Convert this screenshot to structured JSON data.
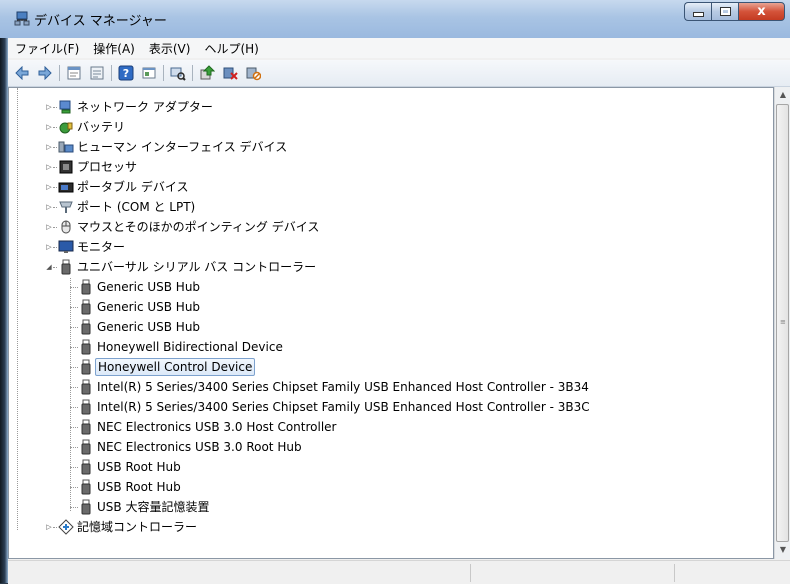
{
  "window": {
    "title": "デバイス マネージャー"
  },
  "caption_buttons": {
    "close_glyph": "x"
  },
  "menu": [
    {
      "label": "ファイル(F)"
    },
    {
      "label": "操作(A)"
    },
    {
      "label": "表示(V)"
    },
    {
      "label": "ヘルプ(H)"
    }
  ],
  "toolbar": [
    {
      "name": "back-icon"
    },
    {
      "name": "forward-icon"
    },
    {
      "name": "properties-icon"
    },
    {
      "name": "show-hide-icon"
    },
    {
      "name": "help-icon"
    },
    {
      "name": "console-icon"
    },
    {
      "name": "scan-hardware-icon"
    },
    {
      "name": "update-driver-icon"
    },
    {
      "name": "uninstall-icon"
    },
    {
      "name": "disable-icon"
    }
  ],
  "tree": {
    "categories_top": [
      {
        "label": "ネットワーク アダプター",
        "icon": "network-adapter-icon"
      },
      {
        "label": "バッテリ",
        "icon": "battery-icon"
      },
      {
        "label": "ヒューマン インターフェイス デバイス",
        "icon": "hid-icon"
      },
      {
        "label": "プロセッサ",
        "icon": "processor-icon"
      },
      {
        "label": "ポータブル デバイス",
        "icon": "portable-device-icon"
      },
      {
        "label": "ポート (COM と LPT)",
        "icon": "port-icon"
      },
      {
        "label": "マウスとそのほかのポインティング デバイス",
        "icon": "mouse-icon"
      },
      {
        "label": "モニター",
        "icon": "monitor-icon"
      }
    ],
    "expanded": {
      "label": "ユニバーサル シリアル バス コントローラー",
      "icon": "usb-icon",
      "children": [
        {
          "label": "Generic USB Hub"
        },
        {
          "label": "Generic USB Hub"
        },
        {
          "label": "Generic USB Hub"
        },
        {
          "label": "Honeywell Bidirectional Device"
        },
        {
          "label": "Honeywell Control Device",
          "selected": true
        },
        {
          "label": "Intel(R) 5 Series/3400 Series Chipset Family USB Enhanced Host Controller - 3B34"
        },
        {
          "label": "Intel(R) 5 Series/3400 Series Chipset Family USB Enhanced Host Controller - 3B3C"
        },
        {
          "label": "NEC Electronics USB 3.0 Host Controller"
        },
        {
          "label": "NEC Electronics USB 3.0 Root Hub"
        },
        {
          "label": "USB Root Hub"
        },
        {
          "label": "USB Root Hub"
        },
        {
          "label": "USB 大容量記憶装置"
        }
      ]
    },
    "categories_bottom": [
      {
        "label": "記憶域コントローラー",
        "icon": "storage-controller-icon"
      }
    ]
  }
}
